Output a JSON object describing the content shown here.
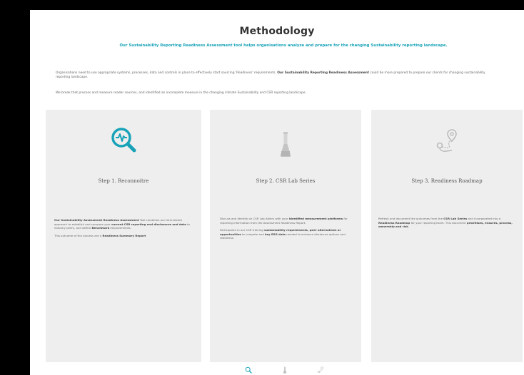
{
  "header": {
    "title": "Methodology",
    "subtitle": "Our Sustainability Reporting Readiness Assessment tool helps organisations analyze and prepare for the changing Sustainability reporting landscape."
  },
  "intro": {
    "p1_a": "Organisations need to use appropriate systems, processes, data and controls in place to effectively start sourcing 'Readiness' requirements.",
    "p1_b": "Our Sustainability Reporting Readiness Assessment",
    "p1_c": "could be more prepared to prepare our clients for changing sustainability reporting landscape.",
    "p2": "We break that process and measure reader sources, and identified an incomplete measure in the changing climate Sustainability and CSR reporting landscape."
  },
  "cards": [
    {
      "title": "Step 1. Reconnoitre",
      "body1_bold": "Our Sustainability Assessment Readiness Assessment",
      "body1_a": "Tool combines our time-tested approach to establish and compare your",
      "body1_bold2": "current CSR reporting and disclosures and data",
      "body1_b": "to industry peers, and define",
      "body1_bold3": "Benchmark",
      "body1_c": "improvements.",
      "body2_a": "This outcome of the process are a",
      "body2_bold": "Readiness Summary Report",
      "body2_b": ""
    },
    {
      "title": "Step 2. CSR Lab Series",
      "body1_a": "Discuss and identify on CSR Lab Ablers with your",
      "body1_bold": "identified measurement platforms",
      "body1_b": "for reporting information from the Assessment Readiness Report.",
      "body2_a": "Participants in our CSR training",
      "body2_bold": "sustainability requirements, peer alternatives or opportunities",
      "body2_b": "to compete and",
      "body2_bold2": "key ESG data",
      "body2_c": "needed to enhance disclosure options and readiness."
    },
    {
      "title": "Step 3. Readiness Roadmap",
      "body1_a": "Refresh and document the outcomes from the",
      "body1_bold": "CSR Lab Series",
      "body1_b": "and incorporated into a",
      "body1_bold2": "Readiness Roadmap",
      "body1_c": "for your reporting team. This document",
      "body1_bold3": "prioritises, ensures, process, ownership and risk",
      "body1_d": "."
    }
  ],
  "colors": {
    "accent": "#17a2b8",
    "card_bg": "#eeeeee",
    "icon_gray": "#bbbbbb"
  },
  "nav": {
    "items": [
      "search-health-icon",
      "flask-icon",
      "route-map-icon"
    ]
  }
}
